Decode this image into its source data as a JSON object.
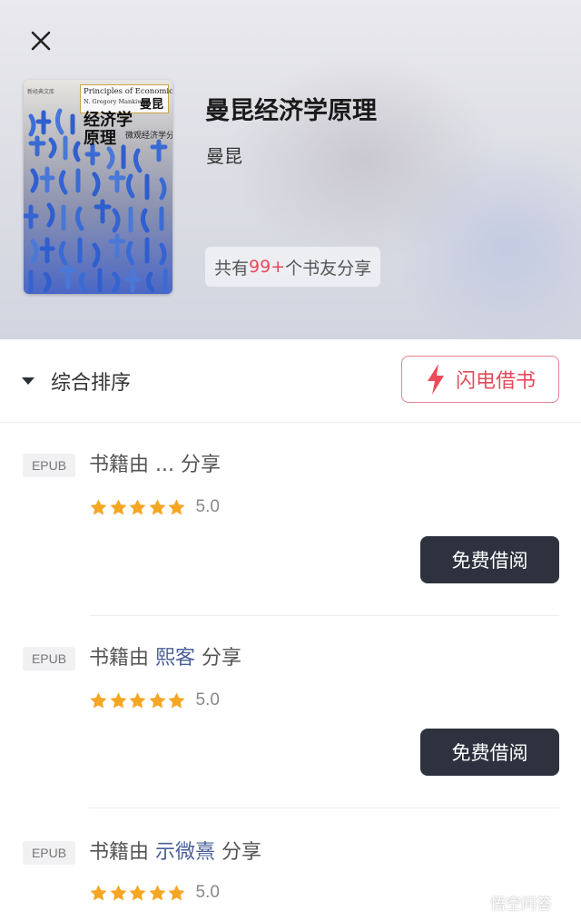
{
  "header": {
    "book_title": "曼昆经济学原理",
    "author": "曼昆",
    "share_prefix": "共有",
    "share_count": "99+",
    "share_suffix": "个书友分享",
    "cover": {
      "logo": "新经典文库",
      "en_title": "Principles of Economics",
      "en_author": "N. Gregory Mankiw",
      "cn_author": "曼昆",
      "cn_title_line1": "经济学",
      "cn_title_line2": "原理",
      "cn_subtitle": "微观经济学分册"
    }
  },
  "sortbar": {
    "sort_label": "综合排序",
    "flash_label": "闪电借书"
  },
  "colors": {
    "accent": "#e64a5a",
    "dark_button": "#2d323e",
    "star": "#f5a623",
    "user_link": "#4a5f97"
  },
  "items": [
    {
      "format": "EPUB",
      "share_prefix": "书籍由",
      "user": "...",
      "share_suffix": "分享",
      "rating": "5.0",
      "stars": 5,
      "button": "免费借阅"
    },
    {
      "format": "EPUB",
      "share_prefix": "书籍由",
      "user": "熙客",
      "share_suffix": "分享",
      "rating": "5.0",
      "stars": 5,
      "button": "免费借阅"
    },
    {
      "format": "EPUB",
      "share_prefix": "书籍由",
      "user": "示微熹",
      "share_suffix": "分享",
      "rating": "5.0",
      "stars": 5
    }
  ],
  "watermark": {
    "icon": "chat-bubble-icon",
    "text": "悟空问答"
  }
}
